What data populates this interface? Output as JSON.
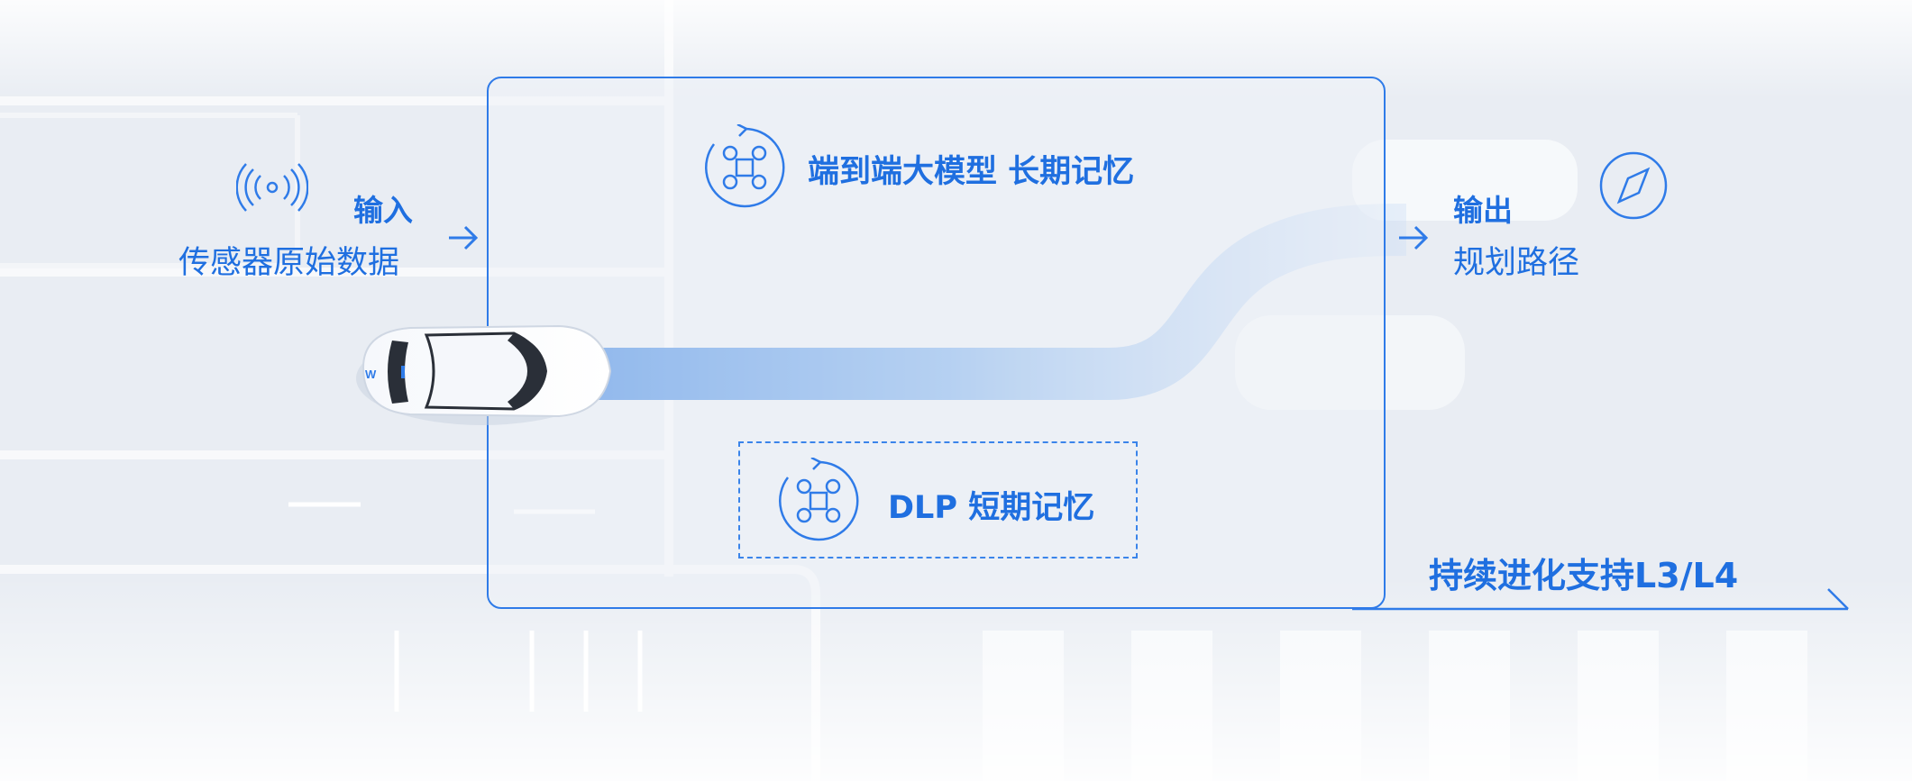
{
  "input": {
    "title": "输入",
    "subtitle": "传感器原始数据",
    "icon": "sensor-signal-icon"
  },
  "output": {
    "title": "输出",
    "subtitle": "规划路径",
    "icon": "compass-icon"
  },
  "long_term": {
    "label": "端到端大模型 长期记忆",
    "icon": "command-cycle-icon"
  },
  "short_term": {
    "label": "DLP 短期记忆",
    "icon": "command-cycle-icon"
  },
  "footer": {
    "label": "持续进化支持L3/L4"
  },
  "car": {
    "badge": "W"
  },
  "colors": {
    "accent": "#1f6fe0",
    "frame": "#2f7be8",
    "background": "#eef1f6"
  }
}
